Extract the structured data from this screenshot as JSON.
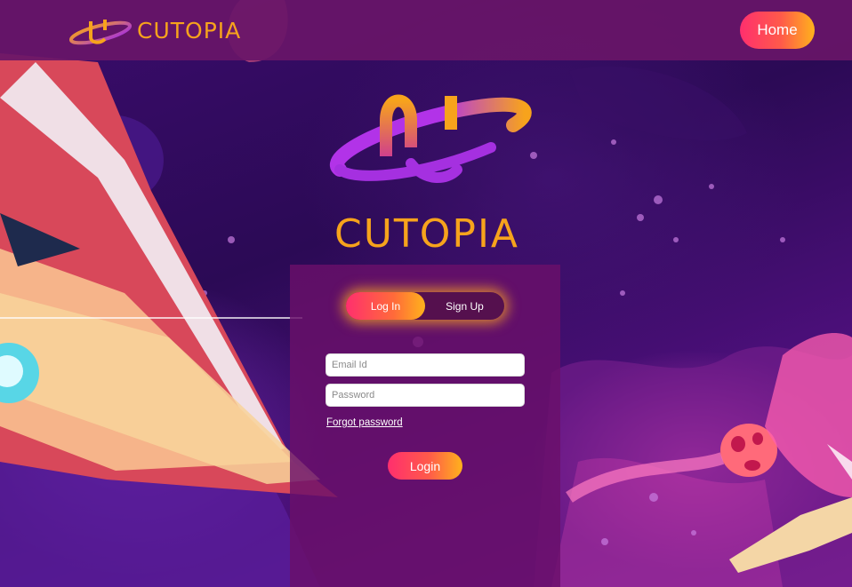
{
  "header": {
    "brand": "CUTOPIA",
    "home_label": "Home"
  },
  "hero": {
    "brand": "CUTOPIA"
  },
  "auth": {
    "tabs": [
      {
        "label": "Log In",
        "active": true
      },
      {
        "label": "Sign Up",
        "active": false
      }
    ],
    "email_placeholder": "Email Id",
    "email_value": "",
    "password_placeholder": "Password",
    "password_value": "",
    "forgot_label": "Forgot password",
    "login_label": "Login"
  },
  "colors": {
    "brand_orange": "#f7a31c",
    "brand_purple": "#a530e0",
    "header_bg": "#681668",
    "button_gradient_start": "#ff2f6e",
    "button_gradient_end": "#ffb21c"
  }
}
